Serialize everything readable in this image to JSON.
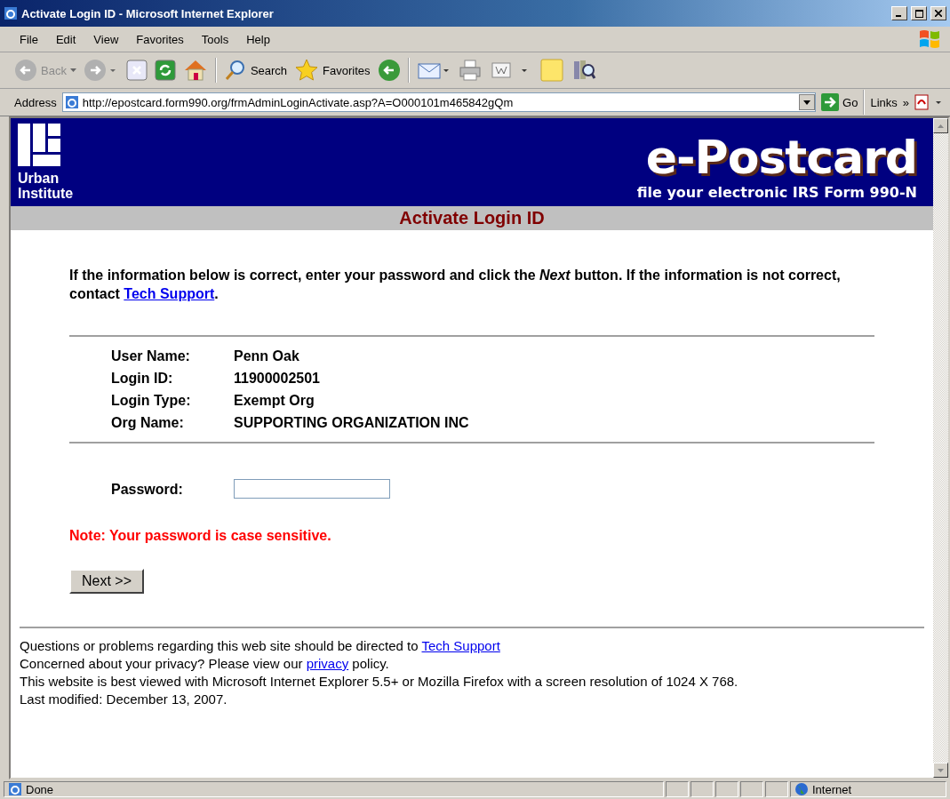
{
  "window": {
    "title": "Activate Login ID - Microsoft Internet Explorer"
  },
  "menu": [
    "File",
    "Edit",
    "View",
    "Favorites",
    "Tools",
    "Help"
  ],
  "toolbar": {
    "back": "Back",
    "search": "Search",
    "favorites": "Favorites"
  },
  "address_bar": {
    "label": "Address",
    "value": "http://epostcard.form990.org/frmAdminLoginActivate.asp?A=O000101m465842gQm",
    "go": "Go",
    "links": "Links",
    "chevron": "»"
  },
  "banner": {
    "org": "Urban Institute",
    "logo": "e-Postcard",
    "tagline": "file your electronic IRS Form 990-N"
  },
  "page_title": "Activate Login ID",
  "intro": {
    "text": "If the information below is correct, enter your password and click the *Next* button. If the information is not correct, contact ",
    "link": "Tech Support",
    "after": "."
  },
  "details": [
    {
      "label": "User Name:",
      "value": "Penn Oak"
    },
    {
      "label": "Login ID:",
      "value": "11900002501"
    },
    {
      "label": "Login Type:",
      "value": "Exempt Org"
    },
    {
      "label": "Org Name:",
      "value": "SUPPORTING ORGANIZATION INC"
    }
  ],
  "password": {
    "label": "Password:"
  },
  "note": "Note: Your password is case sensitive.",
  "next_button": "Next >>",
  "footer": [
    {
      "text": "Questions or problems regarding this web site should be directed to ",
      "link": "Tech Support"
    },
    {
      "text": "Concerned about your privacy? Please view our ",
      "link": "privacy",
      "after": " policy."
    },
    {
      "text": "This website is best viewed with Microsoft Internet Explorer 5.5+ or Mozilla Firefox with a screen resolution of 1024 X 768."
    },
    {
      "text": "Last modified: December 13, 2007."
    }
  ],
  "status_bar": {
    "status": "Done",
    "zone": "Internet"
  }
}
